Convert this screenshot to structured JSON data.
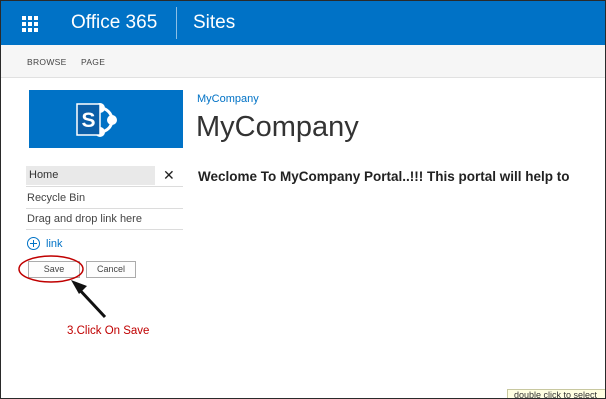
{
  "suite_bar": {
    "brand": "Office 365",
    "app": "Sites"
  },
  "ribbon": {
    "tabs": [
      "BROWSE",
      "PAGE"
    ]
  },
  "site": {
    "breadcrumb": "MyCompany",
    "title": "MyCompany"
  },
  "quick_launch": {
    "items": [
      "Home",
      "Recycle Bin",
      "Drag and drop link here"
    ],
    "add_link_label": "link",
    "save_label": "Save",
    "cancel_label": "Cancel"
  },
  "content": {
    "welcome_text": "Weclome To MyCompany Portal..!!!  This portal will help to"
  },
  "annotation": {
    "text": "3.Click On Save",
    "color": "#c00000"
  },
  "tooltip": {
    "text": "double click to select"
  },
  "colors": {
    "suite_bar": "#0072c6",
    "accent": "#0072c6"
  },
  "icons": {
    "waffle": "app-launcher-icon",
    "logo": "sharepoint-logo",
    "close": "close-icon",
    "add": "add-circle-icon"
  }
}
